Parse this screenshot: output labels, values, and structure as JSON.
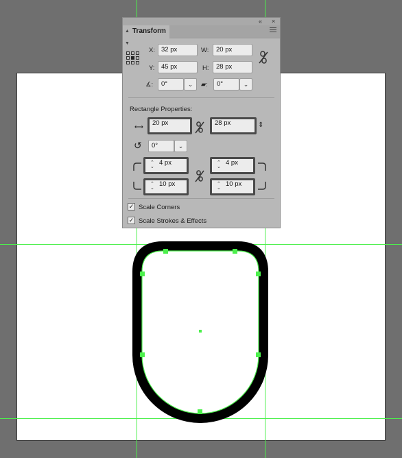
{
  "panel": {
    "title": "Transform",
    "collapse_glyph": "«",
    "close_glyph": "×",
    "x_label": "X:",
    "x_value": "32 px",
    "y_label": "Y:",
    "y_value": "45 px",
    "w_label": "W:",
    "w_value": "20 px",
    "h_label": "H:",
    "h_value": "28 px",
    "angle_value": "0°",
    "shear_value": "0°",
    "rect_heading": "Rectangle Properties:",
    "rect_width": "20 px",
    "rect_height": "28 px",
    "rect_angle": "0°",
    "corner_tl": "4 px",
    "corner_tr": "4 px",
    "corner_bl": "10 px",
    "corner_br": "10 px",
    "scale_corners_label": "Scale Corners",
    "scale_corners_checked": true,
    "scale_strokes_label": "Scale Strokes & Effects",
    "scale_strokes_checked": true
  },
  "canvas": {
    "guide_color": "#4cf04c",
    "shape_stroke_color": "#000000",
    "shape_fill": "#ffffff",
    "anchor_color": "#4cf04c"
  }
}
